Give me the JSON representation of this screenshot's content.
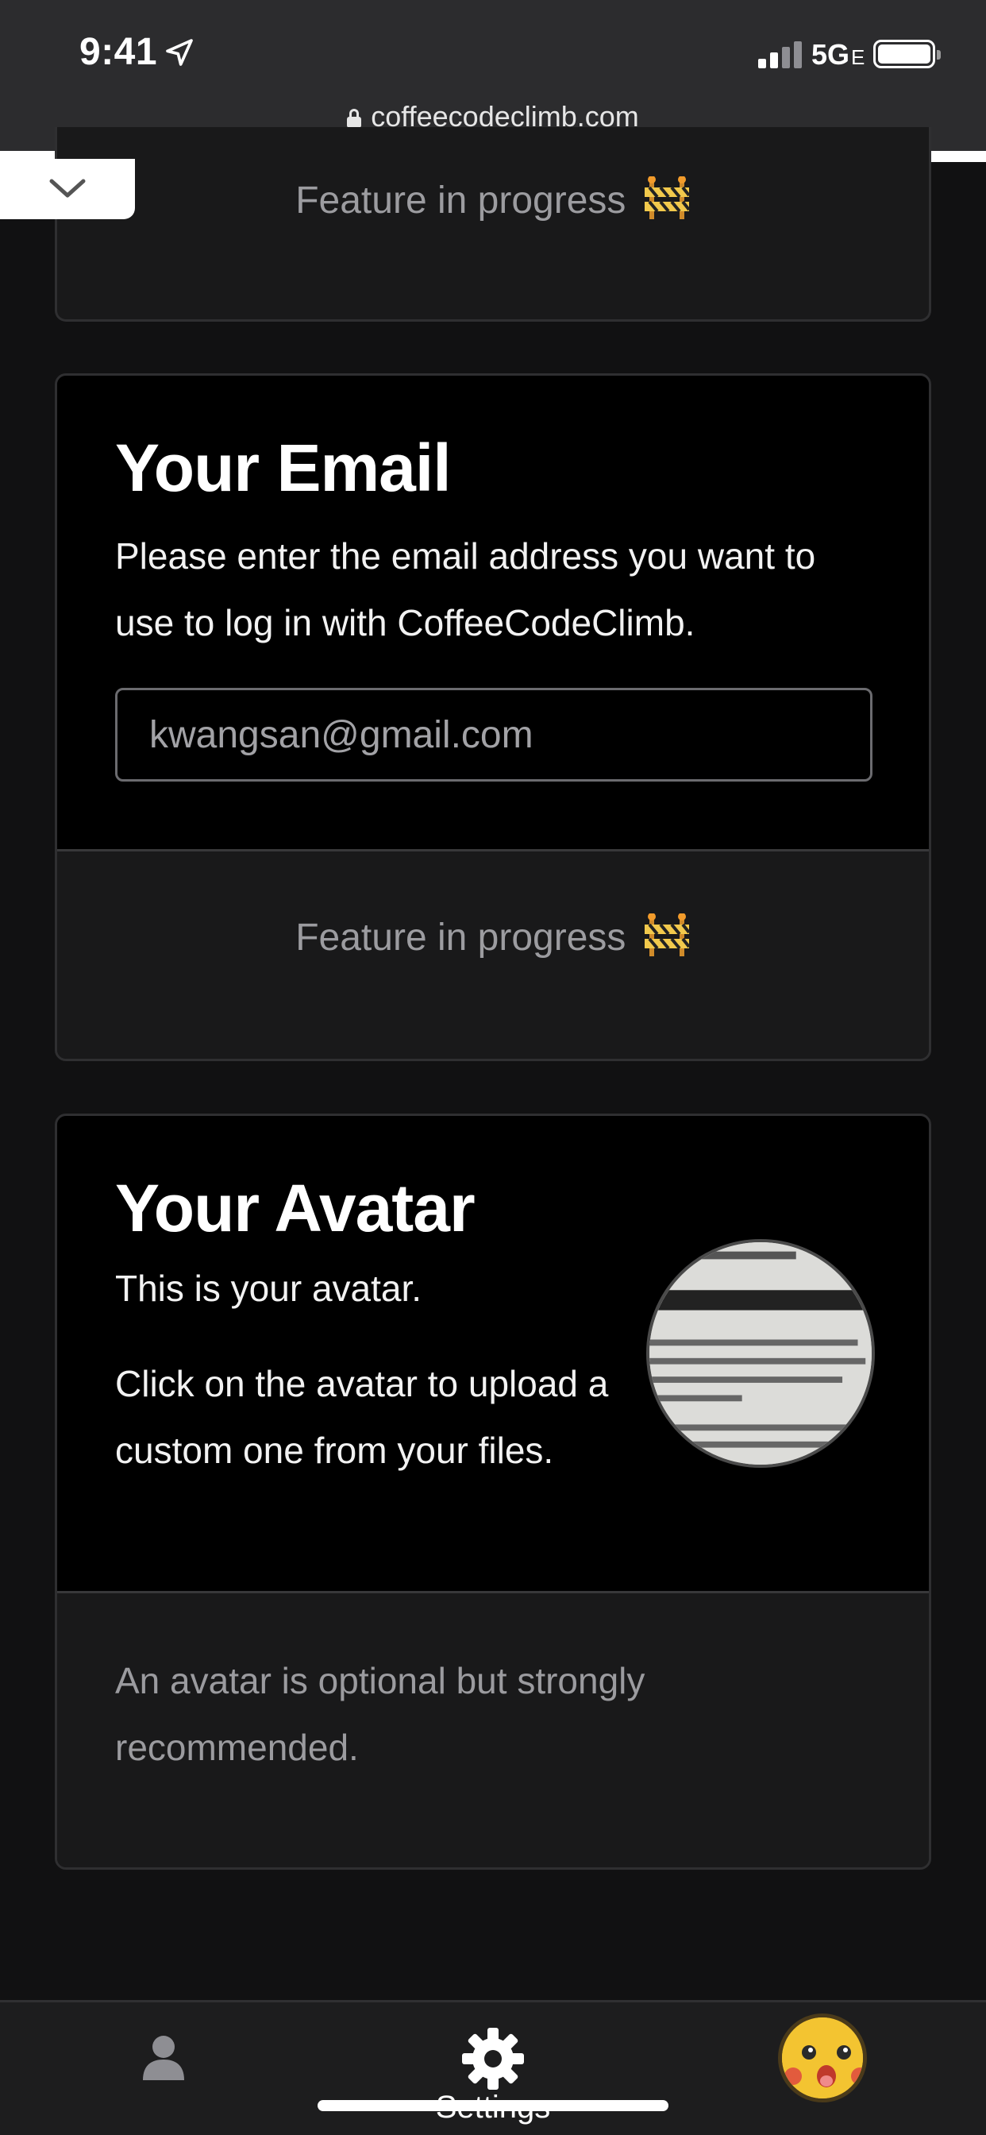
{
  "status_bar": {
    "time": "9:41",
    "network": "5G",
    "network_suffix": "E"
  },
  "browser": {
    "url": "coffeecodeclimb.com"
  },
  "icons": {
    "location": "location-arrow-icon",
    "signal": "signal-bars-icon",
    "battery": "battery-icon",
    "lock": "lock-icon",
    "collapse": "chevron-down-icon",
    "barrier": "construction-barrier-icon",
    "profile": "person-icon",
    "settings": "gear-icon"
  },
  "sections": {
    "top_card": {
      "wip_text": "Feature in progress"
    },
    "email": {
      "title": "Your Email",
      "description": "Please enter the email address you want to use to log in with CoffeeCodeClimb.",
      "input_value": "kwangsan@gmail.com",
      "wip_text": "Feature in progress"
    },
    "avatar": {
      "title": "Your Avatar",
      "line1": "This is your avatar.",
      "line2": "Click on the avatar to upload a custom one from your files.",
      "footer": "An avatar is optional but strongly recommended."
    }
  },
  "tab_bar": {
    "settings_label": "Settings"
  },
  "colors": {
    "page_bg": "#111112",
    "card_bg": "#000000",
    "card_footer_bg": "#19191a",
    "muted_text": "#9b9b9f",
    "status_bar_bg": "#2c2c2e"
  }
}
